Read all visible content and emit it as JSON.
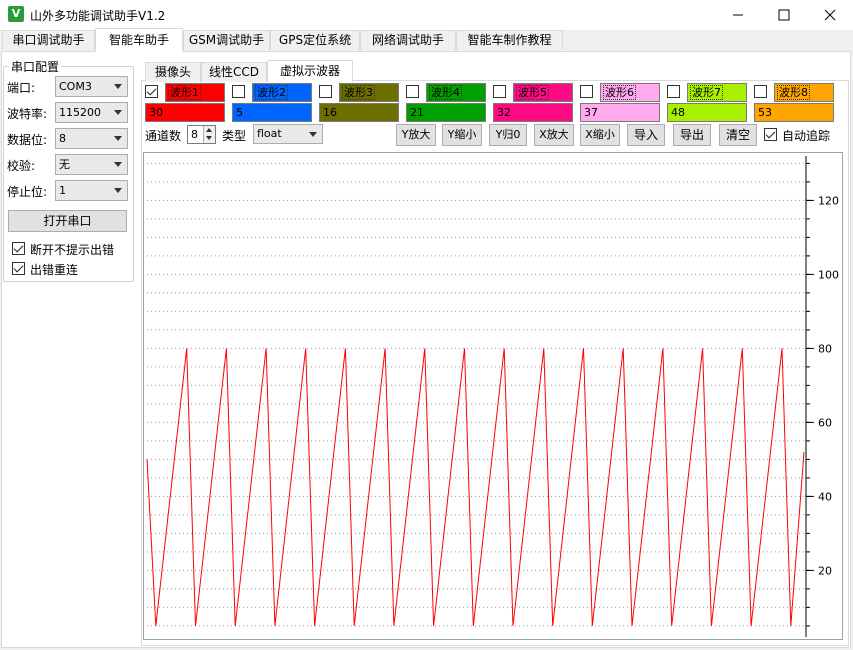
{
  "window": {
    "title": "山外多功能调试助手V1.2",
    "icon": "app-logo-icon"
  },
  "main_tabs": [
    {
      "label": "串口调试助手"
    },
    {
      "label": "智能车助手"
    },
    {
      "label": "GSM调试助手"
    },
    {
      "label": "GPS定位系统"
    },
    {
      "label": "网络调试助手"
    },
    {
      "label": "智能车制作教程"
    }
  ],
  "serial": {
    "group_title": "串口配置",
    "port_label": "端口:",
    "port_value": "COM3",
    "baud_label": "波特率:",
    "baud_value": "115200",
    "databits_label": "数据位:",
    "databits_value": "8",
    "parity_label": "校验:",
    "parity_value": "无",
    "stopbits_label": "停止位:",
    "stopbits_value": "1",
    "open_button": "打开串口",
    "disconnect_no_prompt": "断开不提示出错",
    "reconnect_on_error": "出错重连"
  },
  "sub_tabs": [
    {
      "label": "摄像头"
    },
    {
      "label": "线性CCD"
    },
    {
      "label": "虚拟示波器"
    }
  ],
  "waveforms": [
    {
      "name": "波形1",
      "value": "30",
      "color": "#ff0000",
      "checked": true
    },
    {
      "name": "波形2",
      "value": "5",
      "color": "#0064ff",
      "checked": false
    },
    {
      "name": "波形3",
      "value": "16",
      "color": "#6e6e00",
      "checked": false
    },
    {
      "name": "波形4",
      "value": "21",
      "color": "#00a000",
      "checked": false
    },
    {
      "name": "波形5",
      "value": "32",
      "color": "#ff0a84",
      "checked": false
    },
    {
      "name": "波形6",
      "value": "37",
      "color": "#ffaaee",
      "checked": false
    },
    {
      "name": "波形7",
      "value": "48",
      "color": "#a8f000",
      "checked": false
    },
    {
      "name": "波形8",
      "value": "53",
      "color": "#ffa500",
      "checked": false
    }
  ],
  "controls": {
    "channels_label": "通道数",
    "channels_value": "8",
    "type_label": "类型",
    "type_value": "float",
    "y_zoom_in": "Y放大",
    "y_zoom_out": "Y缩小",
    "y_reset": "Y归0",
    "x_zoom_in": "X放大",
    "x_zoom_out": "X缩小",
    "import": "导入",
    "export": "导出",
    "clear": "清空",
    "auto_track": "自动追踪",
    "auto_track_checked": true
  },
  "chart_data": {
    "type": "line",
    "title": "",
    "xlabel": "",
    "ylabel": "",
    "ylim": [
      2,
      132
    ],
    "yticks": [
      20,
      40,
      60,
      80,
      100,
      120
    ],
    "grid": true,
    "series": [
      {
        "color": "#ff0000",
        "x": [
          0,
          2,
          9,
          11,
          18,
          20,
          27,
          29,
          36,
          38,
          45,
          47,
          54,
          56,
          63,
          65,
          72,
          74,
          81,
          83,
          90,
          92,
          99,
          101,
          108,
          110,
          117,
          119,
          126,
          128,
          135,
          137,
          144,
          146,
          149
        ],
        "values": [
          50,
          5,
          80,
          5,
          80,
          5,
          80,
          5,
          80,
          5,
          80,
          5,
          80,
          5,
          80,
          5,
          80,
          5,
          80,
          5,
          80,
          5,
          80,
          5,
          80,
          5,
          80,
          5,
          80,
          5,
          80,
          5,
          80,
          5,
          52
        ]
      }
    ]
  }
}
